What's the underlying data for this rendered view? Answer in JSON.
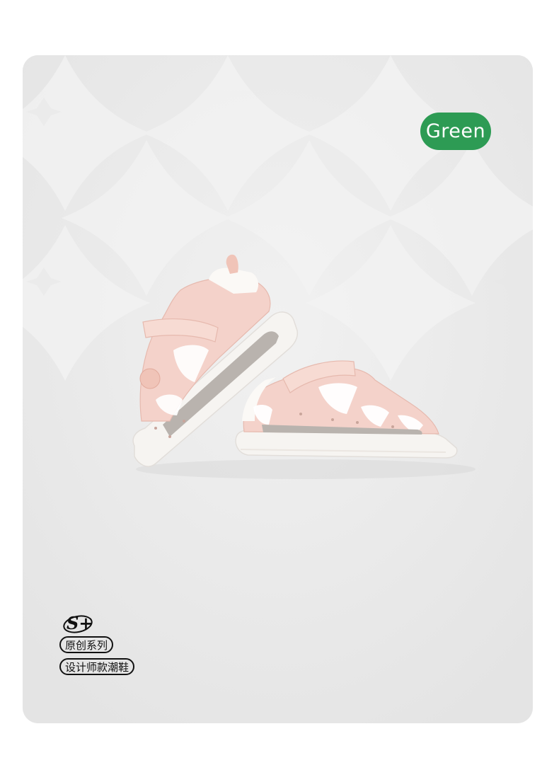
{
  "badge": {
    "color_label": "Green",
    "color_hex": "#2d9b54"
  },
  "product": {
    "image_icon": "baby-sandals-pair-image",
    "shoe_color": "#f3cfc6"
  },
  "brand": {
    "logo_text": "S+",
    "tags": [
      "原创系列",
      "设计师款潮鞋"
    ]
  }
}
